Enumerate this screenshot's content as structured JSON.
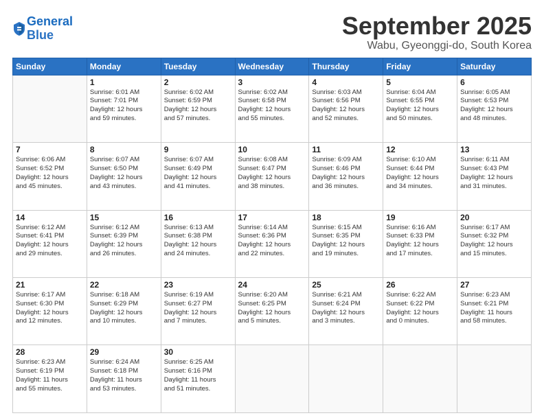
{
  "logo": {
    "line1": "General",
    "line2": "Blue"
  },
  "header": {
    "month": "September 2025",
    "location": "Wabu, Gyeonggi-do, South Korea"
  },
  "weekdays": [
    "Sunday",
    "Monday",
    "Tuesday",
    "Wednesday",
    "Thursday",
    "Friday",
    "Saturday"
  ],
  "weeks": [
    [
      {
        "day": "",
        "info": ""
      },
      {
        "day": "1",
        "info": "Sunrise: 6:01 AM\nSunset: 7:01 PM\nDaylight: 12 hours\nand 59 minutes."
      },
      {
        "day": "2",
        "info": "Sunrise: 6:02 AM\nSunset: 6:59 PM\nDaylight: 12 hours\nand 57 minutes."
      },
      {
        "day": "3",
        "info": "Sunrise: 6:02 AM\nSunset: 6:58 PM\nDaylight: 12 hours\nand 55 minutes."
      },
      {
        "day": "4",
        "info": "Sunrise: 6:03 AM\nSunset: 6:56 PM\nDaylight: 12 hours\nand 52 minutes."
      },
      {
        "day": "5",
        "info": "Sunrise: 6:04 AM\nSunset: 6:55 PM\nDaylight: 12 hours\nand 50 minutes."
      },
      {
        "day": "6",
        "info": "Sunrise: 6:05 AM\nSunset: 6:53 PM\nDaylight: 12 hours\nand 48 minutes."
      }
    ],
    [
      {
        "day": "7",
        "info": "Sunrise: 6:06 AM\nSunset: 6:52 PM\nDaylight: 12 hours\nand 45 minutes."
      },
      {
        "day": "8",
        "info": "Sunrise: 6:07 AM\nSunset: 6:50 PM\nDaylight: 12 hours\nand 43 minutes."
      },
      {
        "day": "9",
        "info": "Sunrise: 6:07 AM\nSunset: 6:49 PM\nDaylight: 12 hours\nand 41 minutes."
      },
      {
        "day": "10",
        "info": "Sunrise: 6:08 AM\nSunset: 6:47 PM\nDaylight: 12 hours\nand 38 minutes."
      },
      {
        "day": "11",
        "info": "Sunrise: 6:09 AM\nSunset: 6:46 PM\nDaylight: 12 hours\nand 36 minutes."
      },
      {
        "day": "12",
        "info": "Sunrise: 6:10 AM\nSunset: 6:44 PM\nDaylight: 12 hours\nand 34 minutes."
      },
      {
        "day": "13",
        "info": "Sunrise: 6:11 AM\nSunset: 6:43 PM\nDaylight: 12 hours\nand 31 minutes."
      }
    ],
    [
      {
        "day": "14",
        "info": "Sunrise: 6:12 AM\nSunset: 6:41 PM\nDaylight: 12 hours\nand 29 minutes."
      },
      {
        "day": "15",
        "info": "Sunrise: 6:12 AM\nSunset: 6:39 PM\nDaylight: 12 hours\nand 26 minutes."
      },
      {
        "day": "16",
        "info": "Sunrise: 6:13 AM\nSunset: 6:38 PM\nDaylight: 12 hours\nand 24 minutes."
      },
      {
        "day": "17",
        "info": "Sunrise: 6:14 AM\nSunset: 6:36 PM\nDaylight: 12 hours\nand 22 minutes."
      },
      {
        "day": "18",
        "info": "Sunrise: 6:15 AM\nSunset: 6:35 PM\nDaylight: 12 hours\nand 19 minutes."
      },
      {
        "day": "19",
        "info": "Sunrise: 6:16 AM\nSunset: 6:33 PM\nDaylight: 12 hours\nand 17 minutes."
      },
      {
        "day": "20",
        "info": "Sunrise: 6:17 AM\nSunset: 6:32 PM\nDaylight: 12 hours\nand 15 minutes."
      }
    ],
    [
      {
        "day": "21",
        "info": "Sunrise: 6:17 AM\nSunset: 6:30 PM\nDaylight: 12 hours\nand 12 minutes."
      },
      {
        "day": "22",
        "info": "Sunrise: 6:18 AM\nSunset: 6:29 PM\nDaylight: 12 hours\nand 10 minutes."
      },
      {
        "day": "23",
        "info": "Sunrise: 6:19 AM\nSunset: 6:27 PM\nDaylight: 12 hours\nand 7 minutes."
      },
      {
        "day": "24",
        "info": "Sunrise: 6:20 AM\nSunset: 6:25 PM\nDaylight: 12 hours\nand 5 minutes."
      },
      {
        "day": "25",
        "info": "Sunrise: 6:21 AM\nSunset: 6:24 PM\nDaylight: 12 hours\nand 3 minutes."
      },
      {
        "day": "26",
        "info": "Sunrise: 6:22 AM\nSunset: 6:22 PM\nDaylight: 12 hours\nand 0 minutes."
      },
      {
        "day": "27",
        "info": "Sunrise: 6:23 AM\nSunset: 6:21 PM\nDaylight: 11 hours\nand 58 minutes."
      }
    ],
    [
      {
        "day": "28",
        "info": "Sunrise: 6:23 AM\nSunset: 6:19 PM\nDaylight: 11 hours\nand 55 minutes."
      },
      {
        "day": "29",
        "info": "Sunrise: 6:24 AM\nSunset: 6:18 PM\nDaylight: 11 hours\nand 53 minutes."
      },
      {
        "day": "30",
        "info": "Sunrise: 6:25 AM\nSunset: 6:16 PM\nDaylight: 11 hours\nand 51 minutes."
      },
      {
        "day": "",
        "info": ""
      },
      {
        "day": "",
        "info": ""
      },
      {
        "day": "",
        "info": ""
      },
      {
        "day": "",
        "info": ""
      }
    ]
  ]
}
